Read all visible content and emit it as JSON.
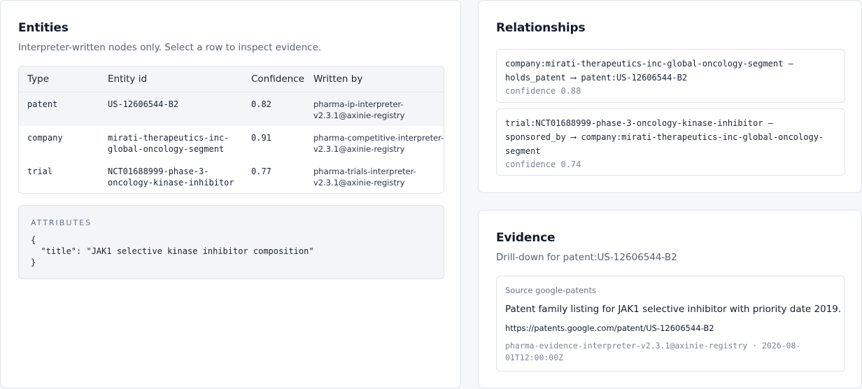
{
  "entities": {
    "title": "Entities",
    "subtitle": "Interpreter-written nodes only. Select a row to inspect evidence.",
    "columns": [
      "Type",
      "Entity id",
      "Confidence",
      "Written by"
    ],
    "rows": [
      {
        "type": "patent",
        "entity_id": [
          "US-12606544-B2"
        ],
        "confidence": "0.82",
        "written_by": [
          "pharma-ip-interpreter-",
          "v2.3.1@axinie-registry"
        ],
        "selected": true
      },
      {
        "type": "company",
        "entity_id": [
          "mirati-therapeutics-inc-",
          "global-oncology-segment"
        ],
        "confidence": "0.91",
        "written_by": [
          "pharma-competitive-interpreter-",
          "v2.3.1@axinie-registry"
        ],
        "selected": false
      },
      {
        "type": "trial",
        "entity_id": [
          "NCT01688999-phase-3-",
          "oncology-kinase-inhibitor"
        ],
        "confidence": "0.77",
        "written_by": [
          "pharma-trials-interpreter-",
          "v2.3.1@axinie-registry"
        ],
        "selected": false
      }
    ],
    "attributes": {
      "label": "ATTRIBUTES",
      "json_lines": [
        "{",
        "  \"title\": \"JAK1 selective kinase inhibitor composition\"",
        "}"
      ]
    }
  },
  "relationships": {
    "title": "Relationships",
    "items": [
      {
        "lines": [
          "company:mirati-therapeutics-inc-global-oncology-segment —",
          "holds_patent ⟶ patent:US-12606544-B2"
        ],
        "confidence": "confidence 0.88"
      },
      {
        "lines": [
          "trial:NCT01688999-phase-3-oncology-kinase-inhibitor —",
          "sponsored_by ⟶ company:mirati-therapeutics-inc-global-oncology-",
          "segment"
        ],
        "confidence": "confidence 0.74"
      }
    ]
  },
  "evidence": {
    "title": "Evidence",
    "subtitle": "Drill-down for patent:US-12606544-B2",
    "source": "Source google-patents",
    "summary": "Patent family listing for JAK1 selective inhibitor with priority date 2019.",
    "url": "https://patents.google.com/patent/US-12606544-B2",
    "meta_lines": [
      "pharma-evidence-interpreter-v2.3.1@axinie-registry · 2026-08-",
      "01T12:00:00Z"
    ]
  }
}
